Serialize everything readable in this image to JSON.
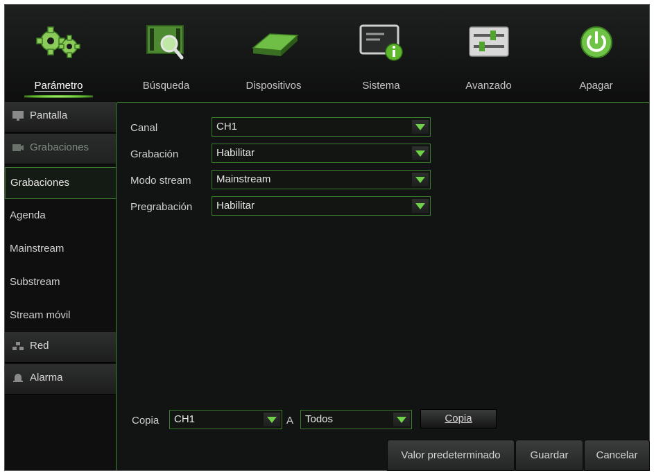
{
  "menu": {
    "items": [
      {
        "label": "Parámetro",
        "icon": "gears-icon",
        "active": true
      },
      {
        "label": "Búsqueda",
        "icon": "search-film-icon",
        "active": false
      },
      {
        "label": "Dispositivos",
        "icon": "hard-drive-icon",
        "active": false
      },
      {
        "label": "Sistema",
        "icon": "system-info-icon",
        "active": false
      },
      {
        "label": "Avanzado",
        "icon": "sliders-icon",
        "active": false
      },
      {
        "label": "Apagar",
        "icon": "power-icon",
        "active": false
      }
    ]
  },
  "sidebar": {
    "pantalla": "Pantalla",
    "grabaciones_group": "Grabaciones",
    "sub": [
      "Grabaciones",
      "Agenda",
      "Mainstream",
      "Substream",
      "Stream móvil"
    ],
    "red": "Red",
    "alarma": "Alarma"
  },
  "form": {
    "canal_label": "Canal",
    "canal_value": "CH1",
    "grabacion_label": "Grabación",
    "grabacion_value": "Habilitar",
    "modo_label": "Modo stream",
    "modo_value": "Mainstream",
    "pregrabacion_label": "Pregrabación",
    "pregrabacion_value": "Habilitar"
  },
  "copy": {
    "label": "Copia",
    "from_value": "CH1",
    "to_label": "A",
    "to_value": "Todos",
    "button": "Copia"
  },
  "footer": {
    "default_button": "Valor predeterminado",
    "save_button": "Guardar",
    "cancel_button": "Cancelar"
  },
  "colors": {
    "accent": "#5fb82c",
    "border": "#3c7d30",
    "background": "#121413"
  }
}
